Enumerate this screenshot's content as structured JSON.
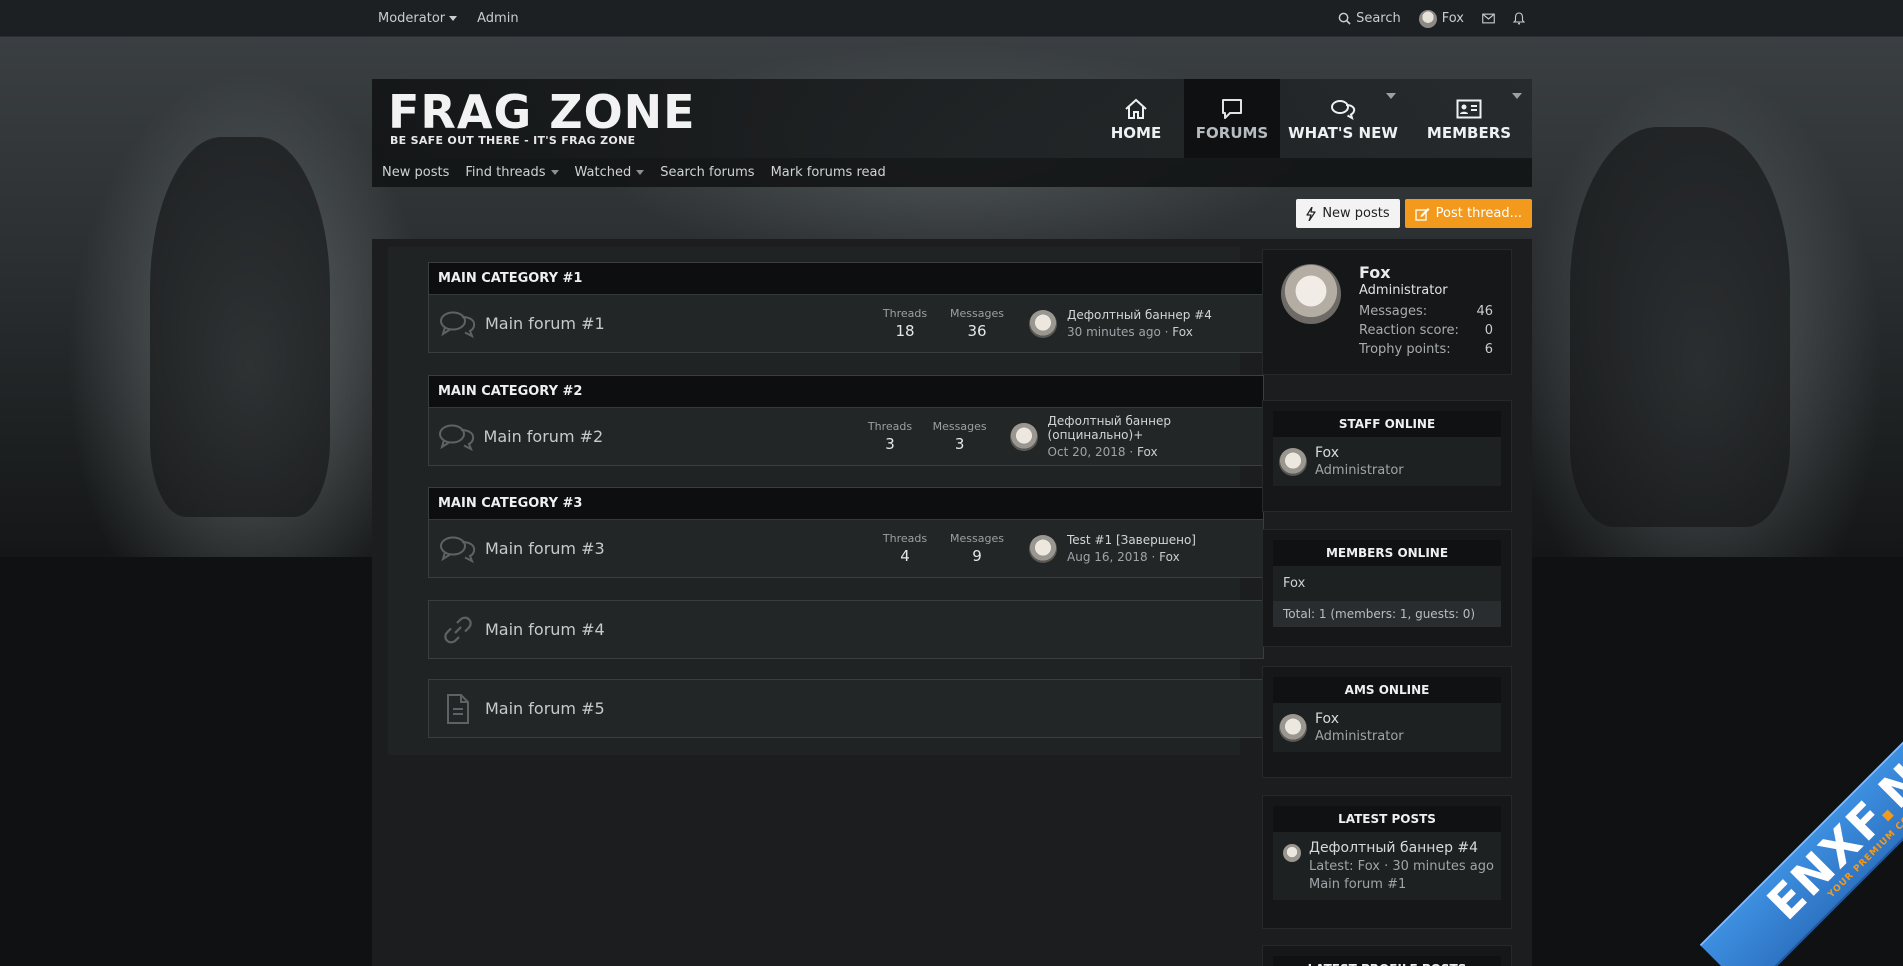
{
  "topbar": {
    "moderator": "Moderator",
    "admin": "Admin",
    "search": "Search",
    "user": "Fox"
  },
  "header": {
    "logo_title": "FRAG ZONE",
    "logo_sub": "BE SAFE OUT THERE - IT'S FRAG ZONE",
    "nav": {
      "home": "HOME",
      "forums": "FORUMS",
      "whats_new": "WHAT'S NEW",
      "members": "MEMBERS"
    }
  },
  "subnav": {
    "new_posts": "New posts",
    "find_threads": "Find threads",
    "watched": "Watched",
    "search_forums": "Search forums",
    "mark_read": "Mark forums read"
  },
  "actions": {
    "new_posts": "New posts",
    "post_thread": "Post thread..."
  },
  "categories": [
    {
      "title": "MAIN CATEGORY #1",
      "forum": {
        "title": "Main forum #1",
        "threads_label": "Threads",
        "threads": "18",
        "messages_label": "Messages",
        "messages": "36",
        "last_title": "Дефолтный баннер #4",
        "last_time": "30 minutes ago",
        "last_sep": "·",
        "last_user": "Fox"
      }
    },
    {
      "title": "MAIN CATEGORY #2",
      "forum": {
        "title": "Main forum #2",
        "threads_label": "Threads",
        "threads": "3",
        "messages_label": "Messages",
        "messages": "3",
        "last_title": "Дефолтный баннер (опцинально)+",
        "last_time": "Oct 20, 2018",
        "last_sep": "·",
        "last_user": "Fox"
      }
    },
    {
      "title": "MAIN CATEGORY #3",
      "forum": {
        "title": "Main forum #3",
        "threads_label": "Threads",
        "threads": "4",
        "messages_label": "Messages",
        "messages": "9",
        "last_title": "Test #1 [Завершено]",
        "last_time": "Aug 16, 2018",
        "last_sep": "·",
        "last_user": "Fox"
      }
    }
  ],
  "link_forum": {
    "title": "Main forum #4"
  },
  "page_forum": {
    "title": "Main forum #5"
  },
  "sidebar": {
    "profile": {
      "name": "Fox",
      "role": "Administrator",
      "messages_label": "Messages:",
      "messages": "46",
      "reaction_label": "Reaction score:",
      "reaction": "0",
      "trophy_label": "Trophy points:",
      "trophy": "6"
    },
    "staff_online": {
      "title": "STAFF ONLINE",
      "name": "Fox",
      "role": "Administrator"
    },
    "members_online": {
      "title": "MEMBERS ONLINE",
      "name": "Fox",
      "total": "Total: 1 (members: 1, guests: 0)"
    },
    "ams_online": {
      "title": "AMS ONLINE",
      "name": "Fox",
      "role": "Administrator"
    },
    "latest_posts": {
      "title": "LATEST POSTS",
      "post_title": "Дефолтный баннер #4",
      "post_meta": "Latest: Fox · 30 minutes ago",
      "post_forum": "Main forum #1"
    },
    "latest_profile_posts": {
      "title": "LATEST PROFILE POSTS"
    }
  },
  "watermark": {
    "brand_a": "ENXF",
    "brand_dot": ".",
    "brand_b": "NET",
    "tagline": "YOUR PREMIUM COMMUNITY"
  },
  "colors": {
    "accent_orange": "#f39a1d",
    "watermark_blue": "#2f74c4"
  }
}
